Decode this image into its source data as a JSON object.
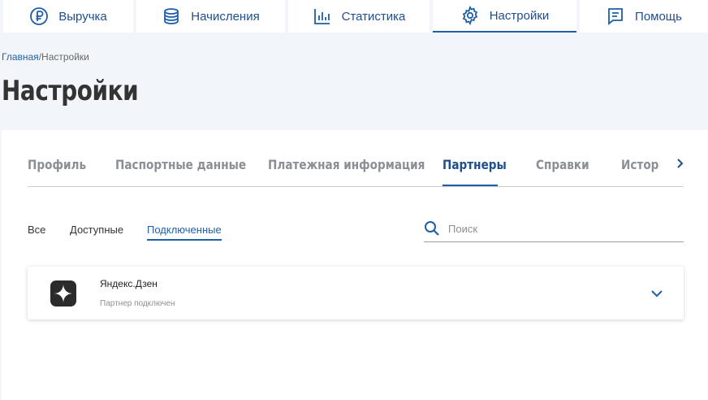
{
  "nav": {
    "items": [
      {
        "label": "Выручка",
        "icon": "ruble-circle-icon",
        "active": false
      },
      {
        "label": "Начисления",
        "icon": "coin-stack-icon",
        "active": false
      },
      {
        "label": "Статистика",
        "icon": "bar-chart-icon",
        "active": false
      },
      {
        "label": "Настройки",
        "icon": "gear-icon",
        "active": true
      },
      {
        "label": "Помощь",
        "icon": "chat-help-icon",
        "active": false
      }
    ]
  },
  "breadcrumb": {
    "home": "Главная",
    "separator": "/",
    "current": "Настройки"
  },
  "page_title": "Настройки",
  "tabs": {
    "items": [
      {
        "label": "Профиль",
        "active": false
      },
      {
        "label": "Паспортные данные",
        "active": false
      },
      {
        "label": "Платежная информация",
        "active": false
      },
      {
        "label": "Партнеры",
        "active": true
      },
      {
        "label": "Справки",
        "active": false
      },
      {
        "label": "История",
        "active": false
      }
    ]
  },
  "filters": {
    "items": [
      {
        "label": "Все",
        "active": false
      },
      {
        "label": "Доступные",
        "active": false
      },
      {
        "label": "Подключенные",
        "active": true
      }
    ]
  },
  "search": {
    "placeholder": "Поиск",
    "value": ""
  },
  "partners": [
    {
      "name": "Яндекс.Дзен",
      "status": "Партнер подключен",
      "logo": "zen-logo-icon"
    }
  ],
  "colors": {
    "accent": "#1f5fa8",
    "nav_text": "#1f4e8c",
    "muted": "#8a8f96",
    "background": "#f2f6fa"
  }
}
